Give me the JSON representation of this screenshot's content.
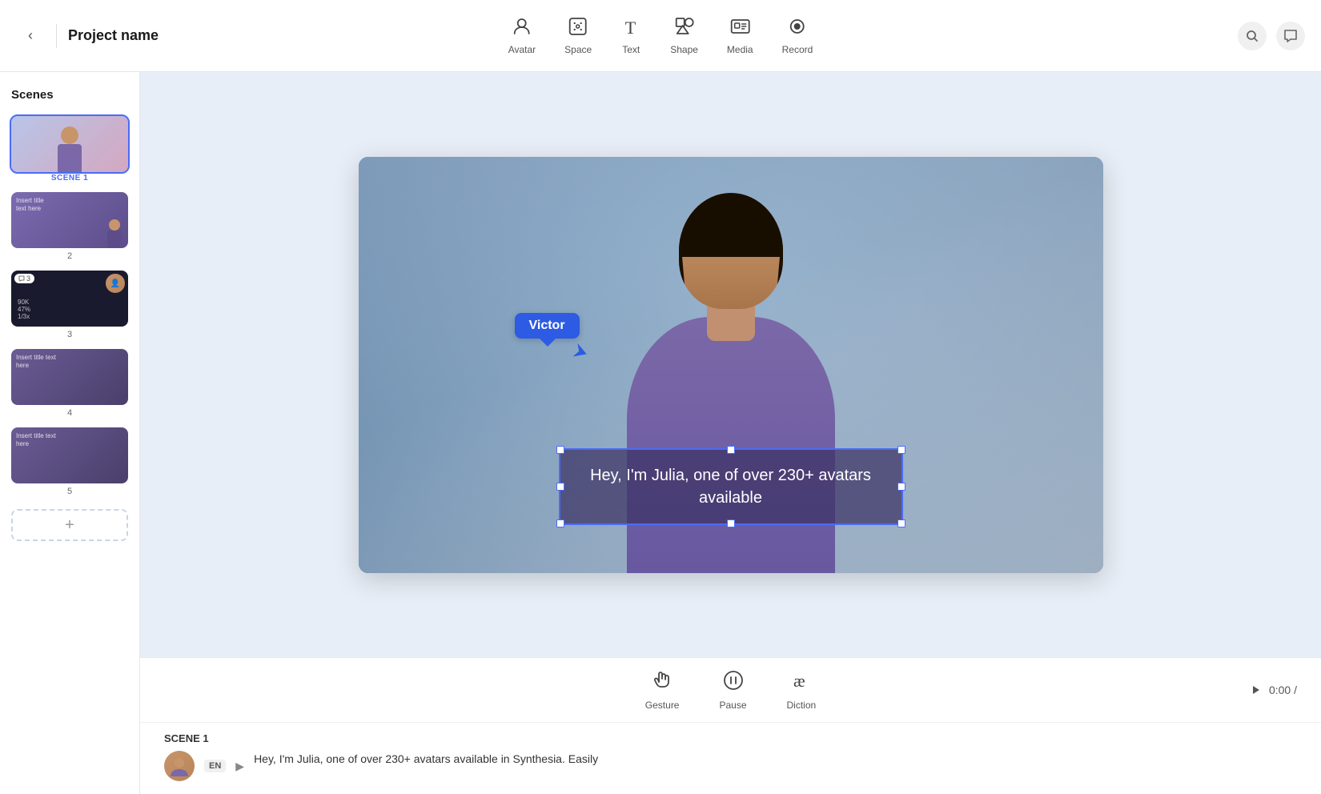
{
  "app": {
    "project_name": "Project name",
    "back_label": "‹"
  },
  "nav": {
    "tools": [
      {
        "id": "avatar",
        "label": "Avatar",
        "icon": "👤"
      },
      {
        "id": "space",
        "label": "Space",
        "icon": "⊡"
      },
      {
        "id": "text",
        "label": "Text",
        "icon": "T"
      },
      {
        "id": "shape",
        "label": "Shape",
        "icon": "◇"
      },
      {
        "id": "media",
        "label": "Media",
        "icon": "▣"
      },
      {
        "id": "record",
        "label": "Record",
        "icon": "⏺"
      }
    ]
  },
  "sidebar": {
    "title": "Scenes",
    "scenes": [
      {
        "id": 1,
        "number": "",
        "label": "SCENE 1",
        "active": true
      },
      {
        "id": 2,
        "number": "2",
        "label": ""
      },
      {
        "id": 3,
        "number": "3",
        "label": ""
      },
      {
        "id": 4,
        "number": "4",
        "label": ""
      },
      {
        "id": 5,
        "number": "5",
        "label": ""
      }
    ],
    "add_btn": "+"
  },
  "canvas": {
    "victor_label": "Victor",
    "overlay_text": "Hey, I'm Julia, one of over 230+ avatars available"
  },
  "playback": {
    "gesture_label": "Gesture",
    "pause_label": "Pause",
    "diction_label": "Diction",
    "time_display": "0:00 /"
  },
  "script": {
    "scene_label": "SCENE 1",
    "lang_badge": "EN",
    "script_text": "Hey, I'm Julia, one of over 230+ avatars available in Synthesia. Easily"
  },
  "scene3": {
    "stats": "90K  47%  1/3x"
  }
}
